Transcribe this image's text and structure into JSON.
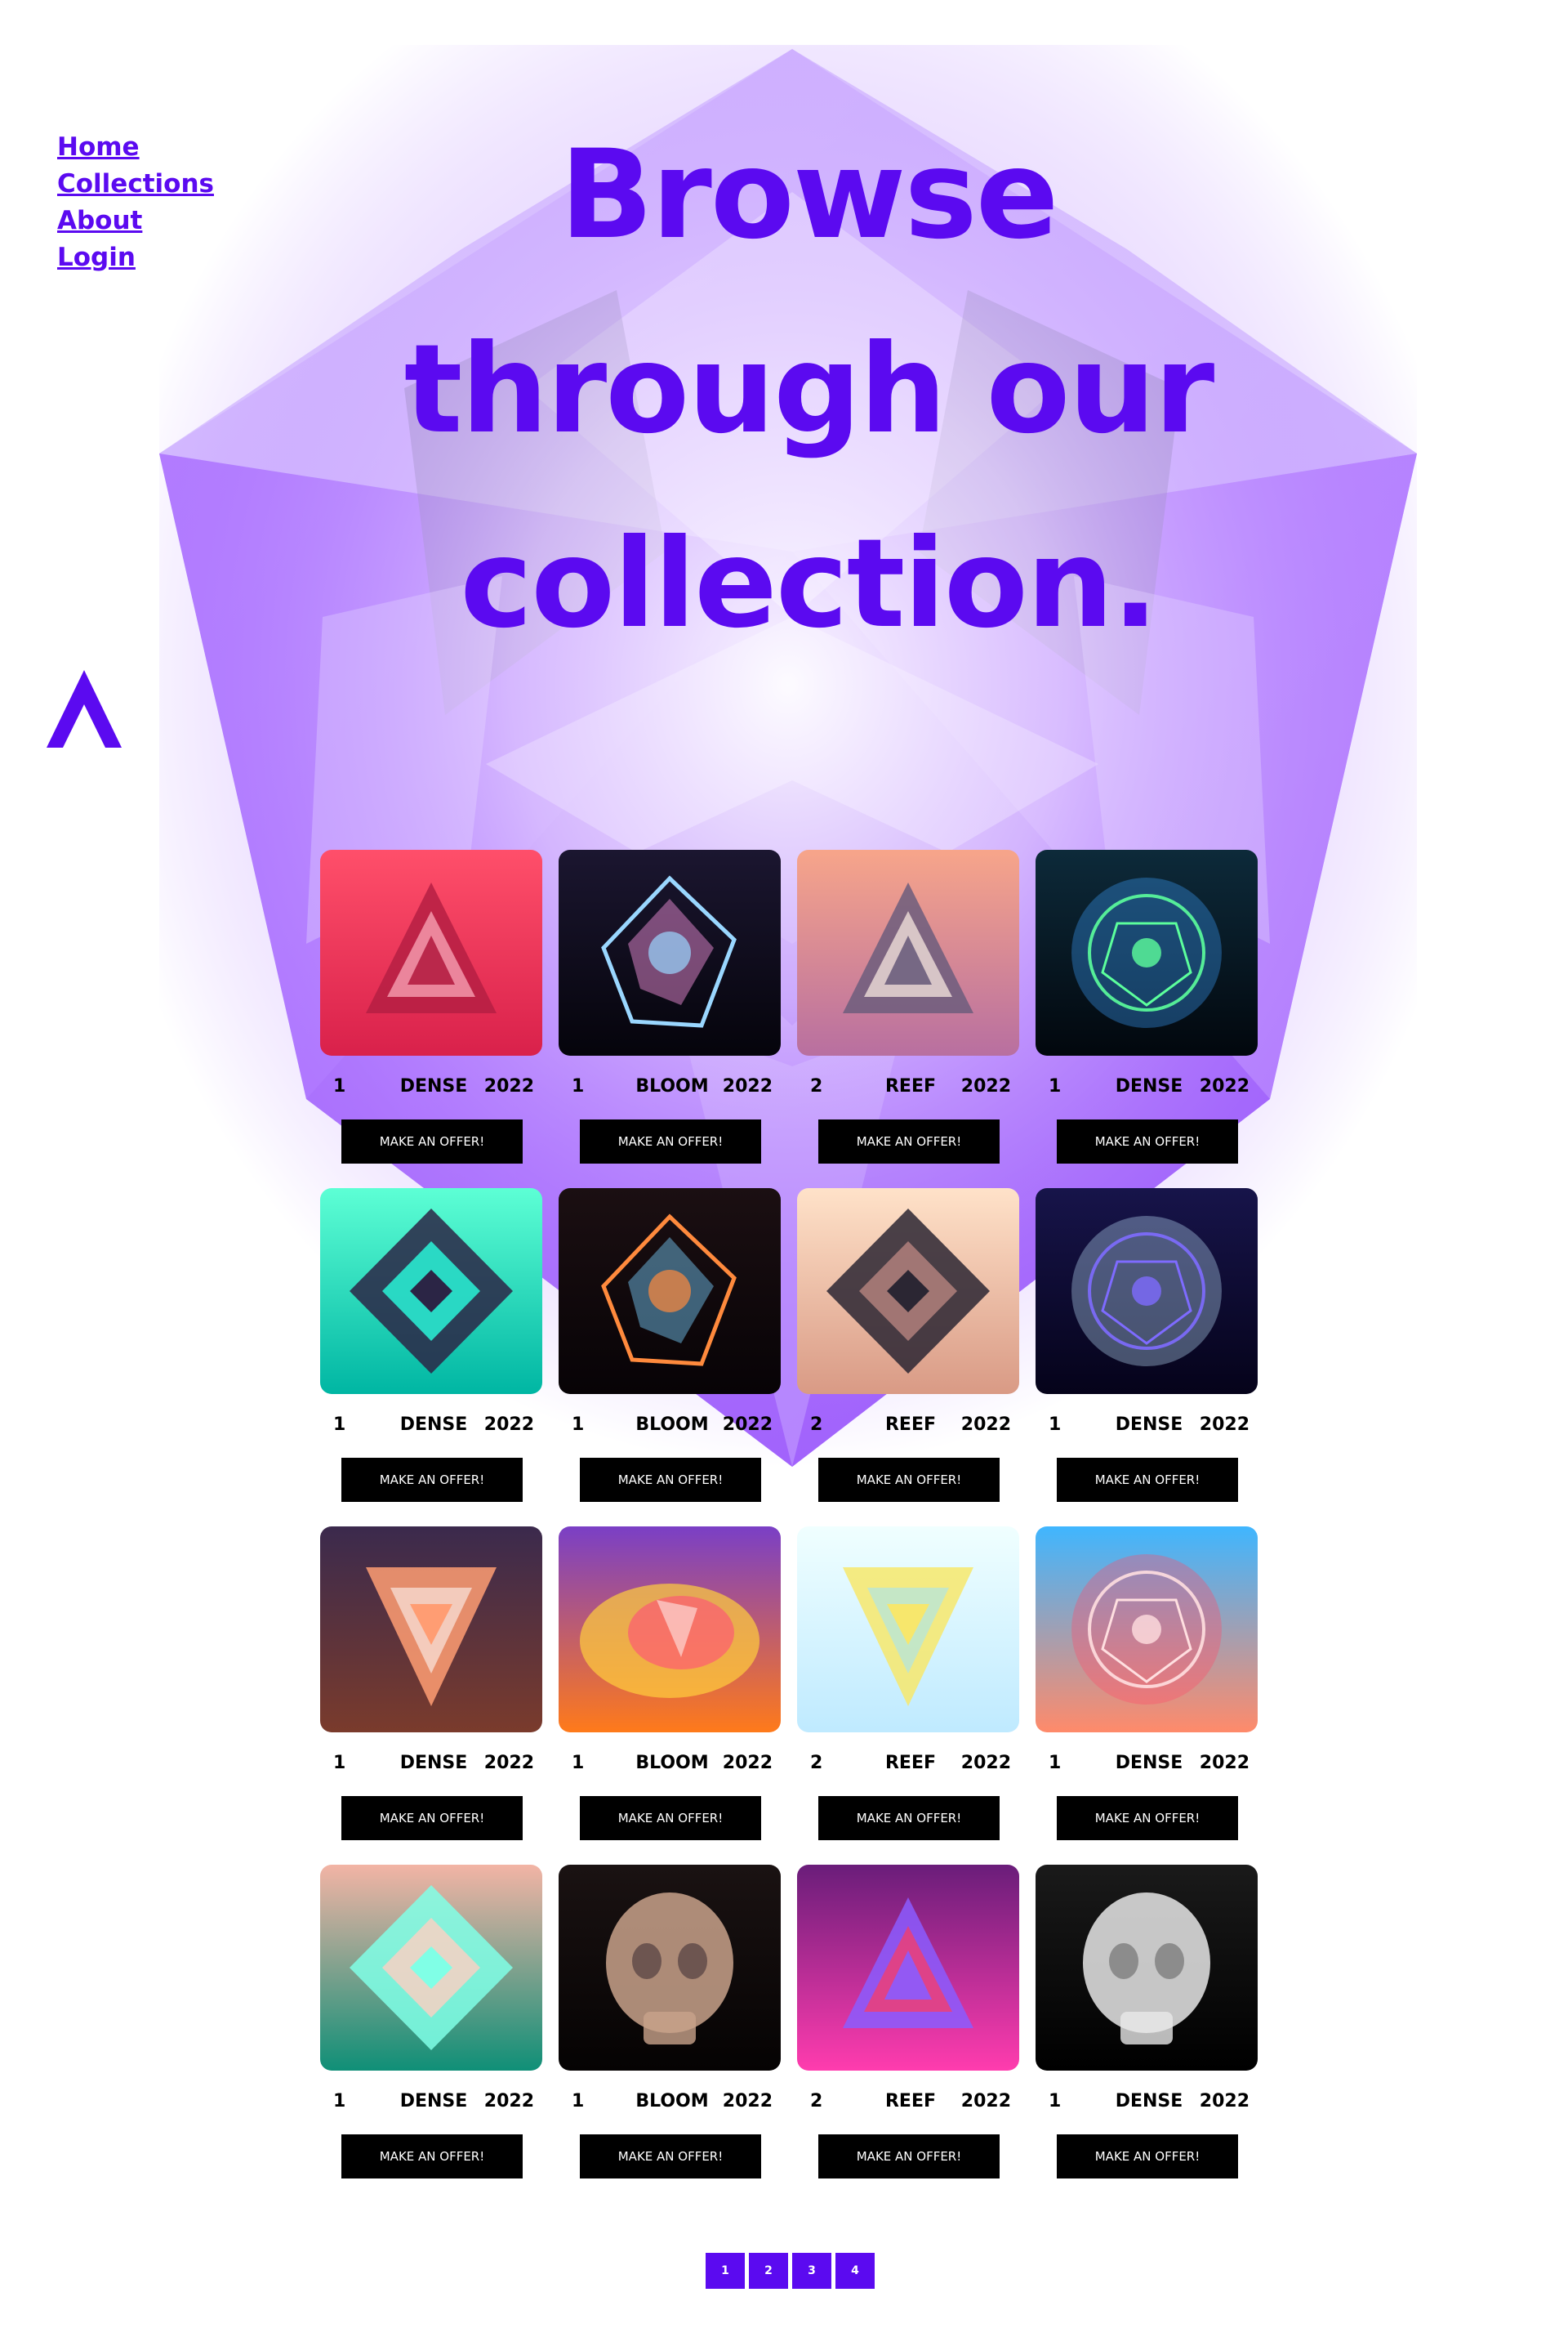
{
  "nav": {
    "items": [
      {
        "label": "Home"
      },
      {
        "label": "Collections"
      },
      {
        "label": "About"
      },
      {
        "label": "Login"
      }
    ]
  },
  "hero": {
    "title": "Browse through our collection."
  },
  "colors": {
    "accent": "#5b0af0",
    "button_bg": "#000000",
    "button_text": "#ffffff"
  },
  "cards": [
    {
      "num": "1",
      "name": "DENSE",
      "year": "2022",
      "button": "MAKE AN OFFER!"
    },
    {
      "num": "1",
      "name": "BLOOM",
      "year": "2022",
      "button": "MAKE AN OFFER!"
    },
    {
      "num": "2",
      "name": "REEF",
      "year": "2022",
      "button": "MAKE AN OFFER!"
    },
    {
      "num": "1",
      "name": "DENSE",
      "year": "2022",
      "button": "MAKE AN OFFER!"
    },
    {
      "num": "1",
      "name": "DENSE",
      "year": "2022",
      "button": "MAKE AN OFFER!"
    },
    {
      "num": "1",
      "name": "BLOOM",
      "year": "2022",
      "button": "MAKE AN OFFER!"
    },
    {
      "num": "2",
      "name": "REEF",
      "year": "2022",
      "button": "MAKE AN OFFER!"
    },
    {
      "num": "1",
      "name": "DENSE",
      "year": "2022",
      "button": "MAKE AN OFFER!"
    },
    {
      "num": "1",
      "name": "DENSE",
      "year": "2022",
      "button": "MAKE AN OFFER!"
    },
    {
      "num": "1",
      "name": "BLOOM",
      "year": "2022",
      "button": "MAKE AN OFFER!"
    },
    {
      "num": "2",
      "name": "REEF",
      "year": "2022",
      "button": "MAKE AN OFFER!"
    },
    {
      "num": "1",
      "name": "DENSE",
      "year": "2022",
      "button": "MAKE AN OFFER!"
    },
    {
      "num": "1",
      "name": "DENSE",
      "year": "2022",
      "button": "MAKE AN OFFER!"
    },
    {
      "num": "1",
      "name": "BLOOM",
      "year": "2022",
      "button": "MAKE AN OFFER!"
    },
    {
      "num": "2",
      "name": "REEF",
      "year": "2022",
      "button": "MAKE AN OFFER!"
    },
    {
      "num": "1",
      "name": "DENSE",
      "year": "2022",
      "button": "MAKE AN OFFER!"
    }
  ],
  "pagination": {
    "pages": [
      "1",
      "2",
      "3",
      "4"
    ]
  }
}
